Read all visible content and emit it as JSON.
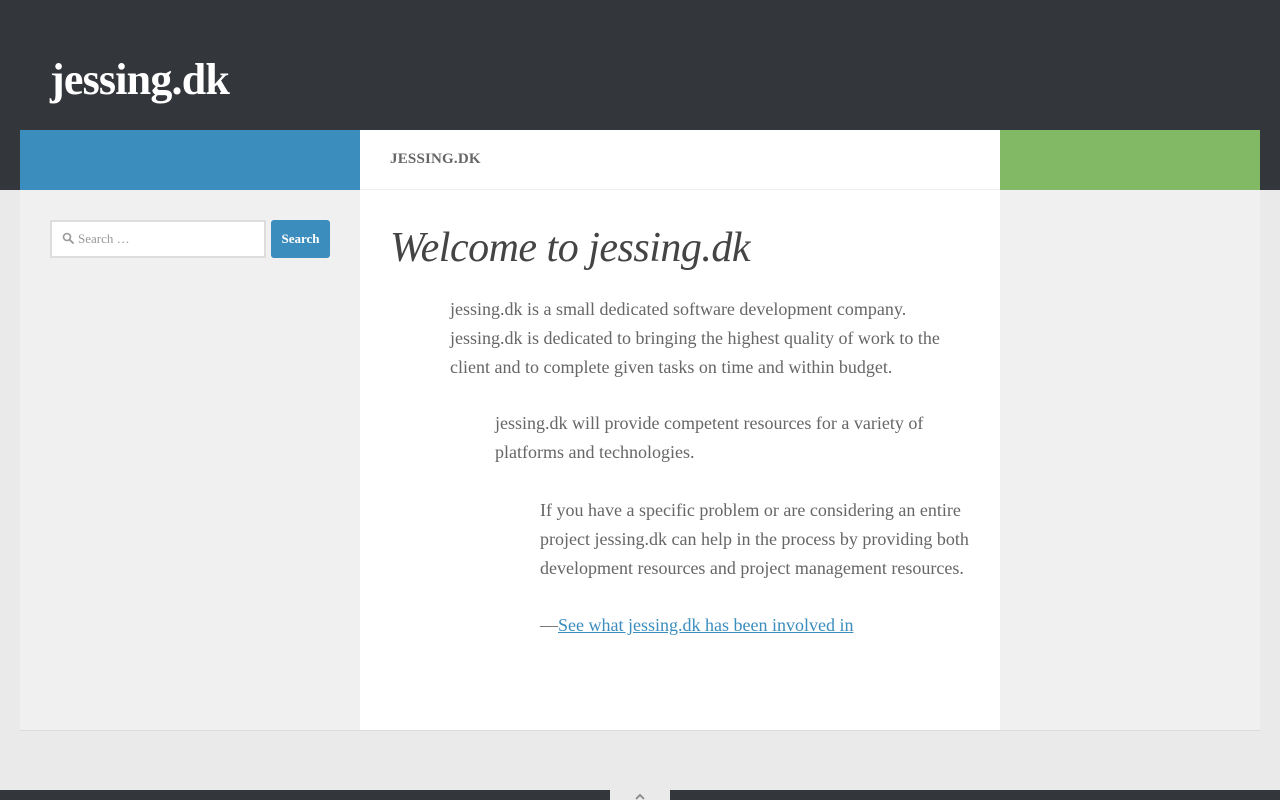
{
  "site": {
    "title": "jessing.dk"
  },
  "search": {
    "placeholder": "Search …",
    "button_label": "Search"
  },
  "page": {
    "header_title": "jessing.dk",
    "title": "Welcome to jessing.dk",
    "quotes": [
      "jessing.dk is a small dedicated software development company. jessing.dk is dedicated to bringing the highest quality of work to the client and to complete given tasks on time and within budget.",
      "jessing.dk will provide competent resources for a variety of platforms and technologies.",
      "If you have a specific problem or are considering an entire project jessing.dk can help in the process by providing both development resources and project management resources."
    ],
    "link_prefix": "—",
    "link_text": "See what jessing.dk has been involved in"
  },
  "colors": {
    "header_bg": "#33363b",
    "accent_blue": "#3b8dbd",
    "accent_green": "#82b965",
    "sidebar_bg": "#f0f0f0",
    "page_bg": "#eaeaea"
  },
  "icons": {
    "search": "search-icon",
    "back_to_top": "chevron-up-icon"
  }
}
